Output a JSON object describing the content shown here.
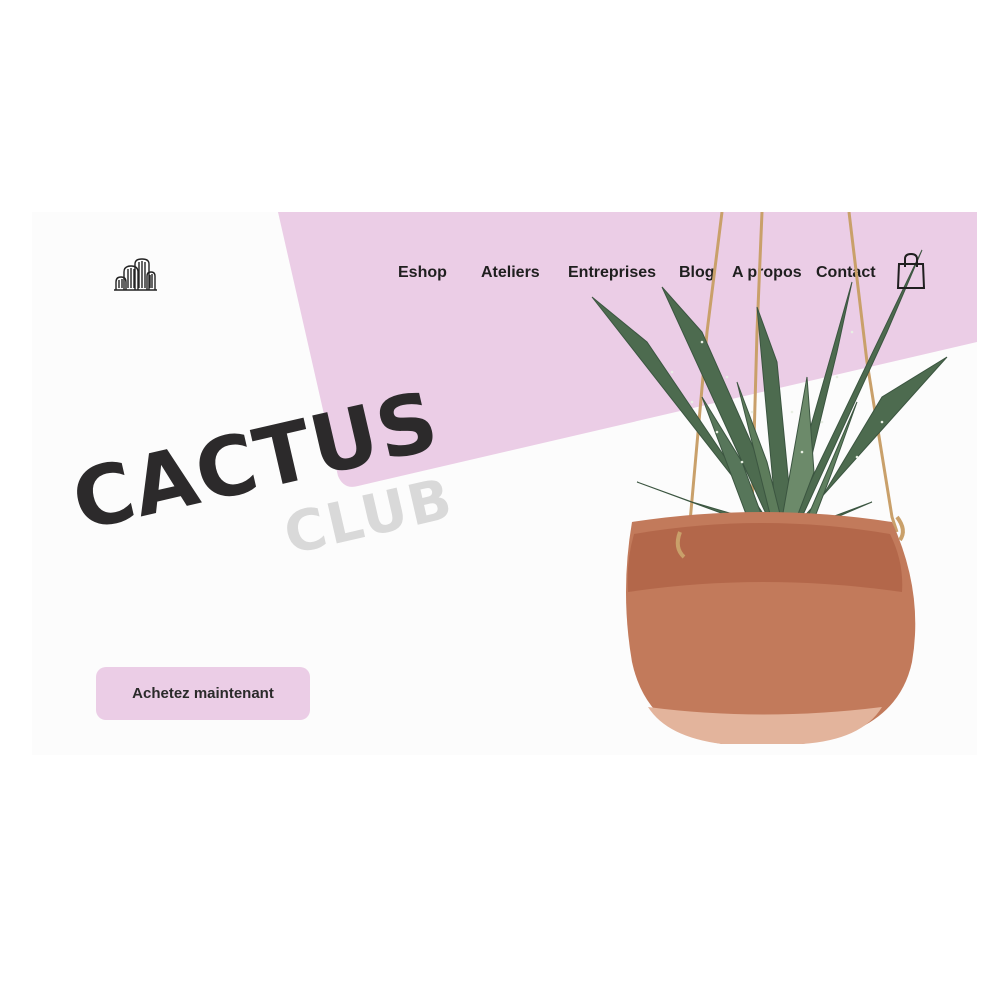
{
  "brand": {
    "logo_icon": "cactus-logo-icon",
    "headline": "CACTUS",
    "subheadline": "CLUB"
  },
  "nav": {
    "items": [
      {
        "label": "Eshop"
      },
      {
        "label": "Ateliers"
      },
      {
        "label": "Entreprises"
      },
      {
        "label": "Blog"
      },
      {
        "label": "A propos"
      },
      {
        "label": "Contact"
      }
    ],
    "cart_icon": "shopping-bag-icon"
  },
  "hero": {
    "cta_label": "Achetez maintenant",
    "image": "hanging-aloe-plant-in-terracotta-pot"
  },
  "colors": {
    "accent_pink": "#ebcde6",
    "headline": "#2c2a2b",
    "subheadline": "#d9d9d9",
    "pot": "#c27a5b"
  }
}
